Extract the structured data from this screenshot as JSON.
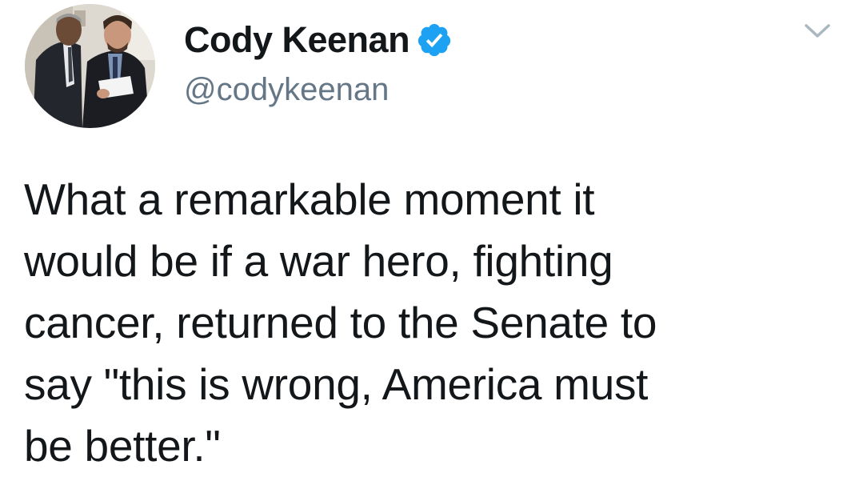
{
  "author": {
    "display_name": "Cody Keenan",
    "handle": "@codykeenan",
    "verified_icon": "verified-badge-icon",
    "avatar_icon": "profile-photo",
    "verified_color": "#1da1f2"
  },
  "tweet": {
    "lines": [
      "What a remarkable moment it",
      "would be if a war hero, fighting",
      "cancer, returned to the Senate to",
      "say \"this is wrong, America must",
      "be better.\""
    ]
  },
  "menu": {
    "icon": "chevron-down-icon"
  },
  "colors": {
    "name": "#14171a",
    "handle": "#657786",
    "text": "#14171a",
    "chevron": "#aab8c2"
  }
}
